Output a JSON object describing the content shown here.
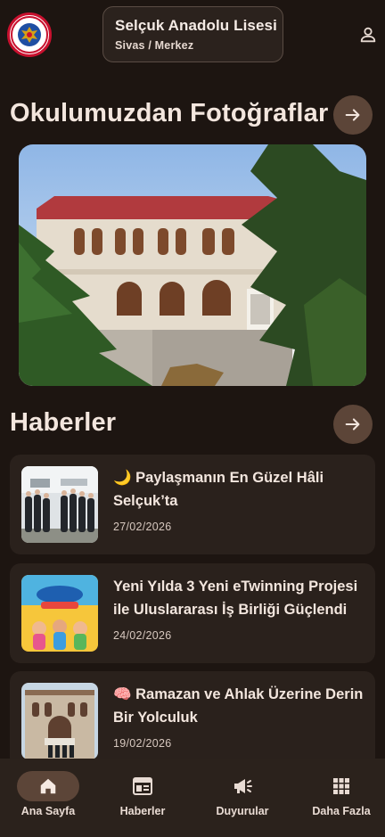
{
  "header": {
    "logo_name": "school-emblem",
    "school_name": "Selçuk Anadolu Lisesi",
    "school_location": "Sivas / Merkez",
    "profile_icon": "person-icon"
  },
  "photos_section": {
    "title": "Okulumuzdan Fotoğraflar",
    "arrow_icon": "arrow-right-icon"
  },
  "news_section": {
    "title": "Haberler",
    "arrow_icon": "arrow-right-icon",
    "items": [
      {
        "title": "🌙 Paylaşmanın En Güzel Hâli Selçuk’ta",
        "date": "27/02/2026"
      },
      {
        "title": " Yeni Yılda 3 Yeni eTwinning Projesi ile Uluslararası İş Birliği Güçlendi",
        "date": "24/02/2026"
      },
      {
        "title": "🧠 Ramazan ve Ahlak Üzerine Derin Bir Yolculuk",
        "date": "19/02/2026"
      }
    ]
  },
  "bottom_nav": {
    "items": [
      {
        "label": "Ana Sayfa",
        "icon": "home-icon",
        "active": true
      },
      {
        "label": "Haberler",
        "icon": "newspaper-icon",
        "active": false
      },
      {
        "label": "Duyurular",
        "icon": "megaphone-icon",
        "active": false
      },
      {
        "label": "Daha Fazla",
        "icon": "grid-icon",
        "active": false
      }
    ]
  },
  "colors": {
    "background": "#1d1511",
    "card": "#2a211c",
    "accent_pill": "#5c4538",
    "text": "#f3e6de"
  }
}
